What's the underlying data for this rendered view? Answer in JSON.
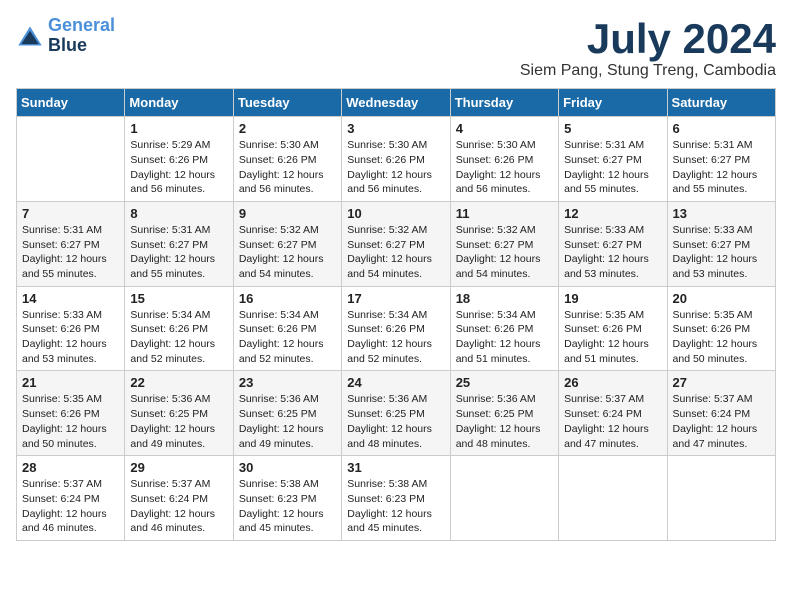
{
  "header": {
    "logo_line1": "General",
    "logo_line2": "Blue",
    "month_year": "July 2024",
    "location": "Siem Pang, Stung Treng, Cambodia"
  },
  "days_of_week": [
    "Sunday",
    "Monday",
    "Tuesday",
    "Wednesday",
    "Thursday",
    "Friday",
    "Saturday"
  ],
  "weeks": [
    [
      {
        "day": "",
        "info": ""
      },
      {
        "day": "1",
        "info": "Sunrise: 5:29 AM\nSunset: 6:26 PM\nDaylight: 12 hours\nand 56 minutes."
      },
      {
        "day": "2",
        "info": "Sunrise: 5:30 AM\nSunset: 6:26 PM\nDaylight: 12 hours\nand 56 minutes."
      },
      {
        "day": "3",
        "info": "Sunrise: 5:30 AM\nSunset: 6:26 PM\nDaylight: 12 hours\nand 56 minutes."
      },
      {
        "day": "4",
        "info": "Sunrise: 5:30 AM\nSunset: 6:26 PM\nDaylight: 12 hours\nand 56 minutes."
      },
      {
        "day": "5",
        "info": "Sunrise: 5:31 AM\nSunset: 6:27 PM\nDaylight: 12 hours\nand 55 minutes."
      },
      {
        "day": "6",
        "info": "Sunrise: 5:31 AM\nSunset: 6:27 PM\nDaylight: 12 hours\nand 55 minutes."
      }
    ],
    [
      {
        "day": "7",
        "info": "Sunrise: 5:31 AM\nSunset: 6:27 PM\nDaylight: 12 hours\nand 55 minutes."
      },
      {
        "day": "8",
        "info": "Sunrise: 5:31 AM\nSunset: 6:27 PM\nDaylight: 12 hours\nand 55 minutes."
      },
      {
        "day": "9",
        "info": "Sunrise: 5:32 AM\nSunset: 6:27 PM\nDaylight: 12 hours\nand 54 minutes."
      },
      {
        "day": "10",
        "info": "Sunrise: 5:32 AM\nSunset: 6:27 PM\nDaylight: 12 hours\nand 54 minutes."
      },
      {
        "day": "11",
        "info": "Sunrise: 5:32 AM\nSunset: 6:27 PM\nDaylight: 12 hours\nand 54 minutes."
      },
      {
        "day": "12",
        "info": "Sunrise: 5:33 AM\nSunset: 6:27 PM\nDaylight: 12 hours\nand 53 minutes."
      },
      {
        "day": "13",
        "info": "Sunrise: 5:33 AM\nSunset: 6:27 PM\nDaylight: 12 hours\nand 53 minutes."
      }
    ],
    [
      {
        "day": "14",
        "info": "Sunrise: 5:33 AM\nSunset: 6:26 PM\nDaylight: 12 hours\nand 53 minutes."
      },
      {
        "day": "15",
        "info": "Sunrise: 5:34 AM\nSunset: 6:26 PM\nDaylight: 12 hours\nand 52 minutes."
      },
      {
        "day": "16",
        "info": "Sunrise: 5:34 AM\nSunset: 6:26 PM\nDaylight: 12 hours\nand 52 minutes."
      },
      {
        "day": "17",
        "info": "Sunrise: 5:34 AM\nSunset: 6:26 PM\nDaylight: 12 hours\nand 52 minutes."
      },
      {
        "day": "18",
        "info": "Sunrise: 5:34 AM\nSunset: 6:26 PM\nDaylight: 12 hours\nand 51 minutes."
      },
      {
        "day": "19",
        "info": "Sunrise: 5:35 AM\nSunset: 6:26 PM\nDaylight: 12 hours\nand 51 minutes."
      },
      {
        "day": "20",
        "info": "Sunrise: 5:35 AM\nSunset: 6:26 PM\nDaylight: 12 hours\nand 50 minutes."
      }
    ],
    [
      {
        "day": "21",
        "info": "Sunrise: 5:35 AM\nSunset: 6:26 PM\nDaylight: 12 hours\nand 50 minutes."
      },
      {
        "day": "22",
        "info": "Sunrise: 5:36 AM\nSunset: 6:25 PM\nDaylight: 12 hours\nand 49 minutes."
      },
      {
        "day": "23",
        "info": "Sunrise: 5:36 AM\nSunset: 6:25 PM\nDaylight: 12 hours\nand 49 minutes."
      },
      {
        "day": "24",
        "info": "Sunrise: 5:36 AM\nSunset: 6:25 PM\nDaylight: 12 hours\nand 48 minutes."
      },
      {
        "day": "25",
        "info": "Sunrise: 5:36 AM\nSunset: 6:25 PM\nDaylight: 12 hours\nand 48 minutes."
      },
      {
        "day": "26",
        "info": "Sunrise: 5:37 AM\nSunset: 6:24 PM\nDaylight: 12 hours\nand 47 minutes."
      },
      {
        "day": "27",
        "info": "Sunrise: 5:37 AM\nSunset: 6:24 PM\nDaylight: 12 hours\nand 47 minutes."
      }
    ],
    [
      {
        "day": "28",
        "info": "Sunrise: 5:37 AM\nSunset: 6:24 PM\nDaylight: 12 hours\nand 46 minutes."
      },
      {
        "day": "29",
        "info": "Sunrise: 5:37 AM\nSunset: 6:24 PM\nDaylight: 12 hours\nand 46 minutes."
      },
      {
        "day": "30",
        "info": "Sunrise: 5:38 AM\nSunset: 6:23 PM\nDaylight: 12 hours\nand 45 minutes."
      },
      {
        "day": "31",
        "info": "Sunrise: 5:38 AM\nSunset: 6:23 PM\nDaylight: 12 hours\nand 45 minutes."
      },
      {
        "day": "",
        "info": ""
      },
      {
        "day": "",
        "info": ""
      },
      {
        "day": "",
        "info": ""
      }
    ]
  ]
}
